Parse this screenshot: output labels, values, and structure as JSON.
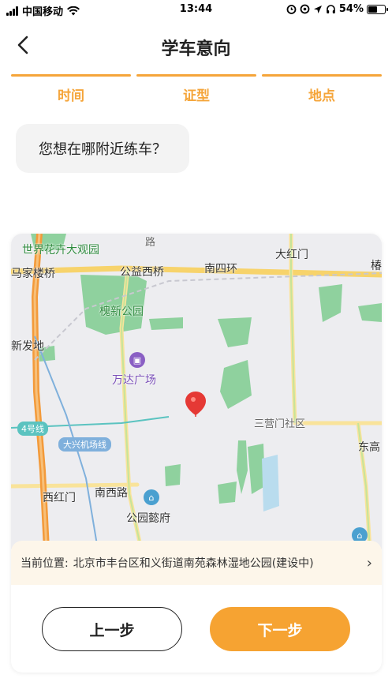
{
  "status_bar": {
    "carrier": "中国移动",
    "time": "13:44",
    "battery": "54%",
    "battery_level": 0.54
  },
  "header": {
    "title": "学车意向",
    "back_icon": "chevron-left-icon"
  },
  "steps": [
    {
      "label": "时间"
    },
    {
      "label": "证型"
    },
    {
      "label": "地点"
    }
  ],
  "question": "您想在哪附近练车？",
  "map": {
    "labels": {
      "park_garden": "世界花卉大观园",
      "road_lu": "路",
      "majialou": "马家楼桥",
      "gongyixi": "公益西桥",
      "nansihuan": "南四环",
      "dahongmen": "大红门",
      "edge_right": "椿",
      "huaixin_park": "槐新公园",
      "xinfadi": "新发地",
      "wanda": "万达广场",
      "sanyingmen": "三营门社区",
      "line4": "4号线",
      "daxing_line": "大兴机场线",
      "donggao": "东高",
      "xihongmen": "西红门",
      "nanxi_road": "南西路",
      "gongyuan_yifu": "公园懿府"
    },
    "pin_color": "#e53935"
  },
  "location": {
    "prefix": "当前位置:",
    "address": "北京市丰台区和义街道南苑森林湿地公园(建设中)"
  },
  "buttons": {
    "prev": "上一步",
    "next": "下一步"
  },
  "colors": {
    "accent": "#f5a53a",
    "next_button": "#f6a332"
  }
}
